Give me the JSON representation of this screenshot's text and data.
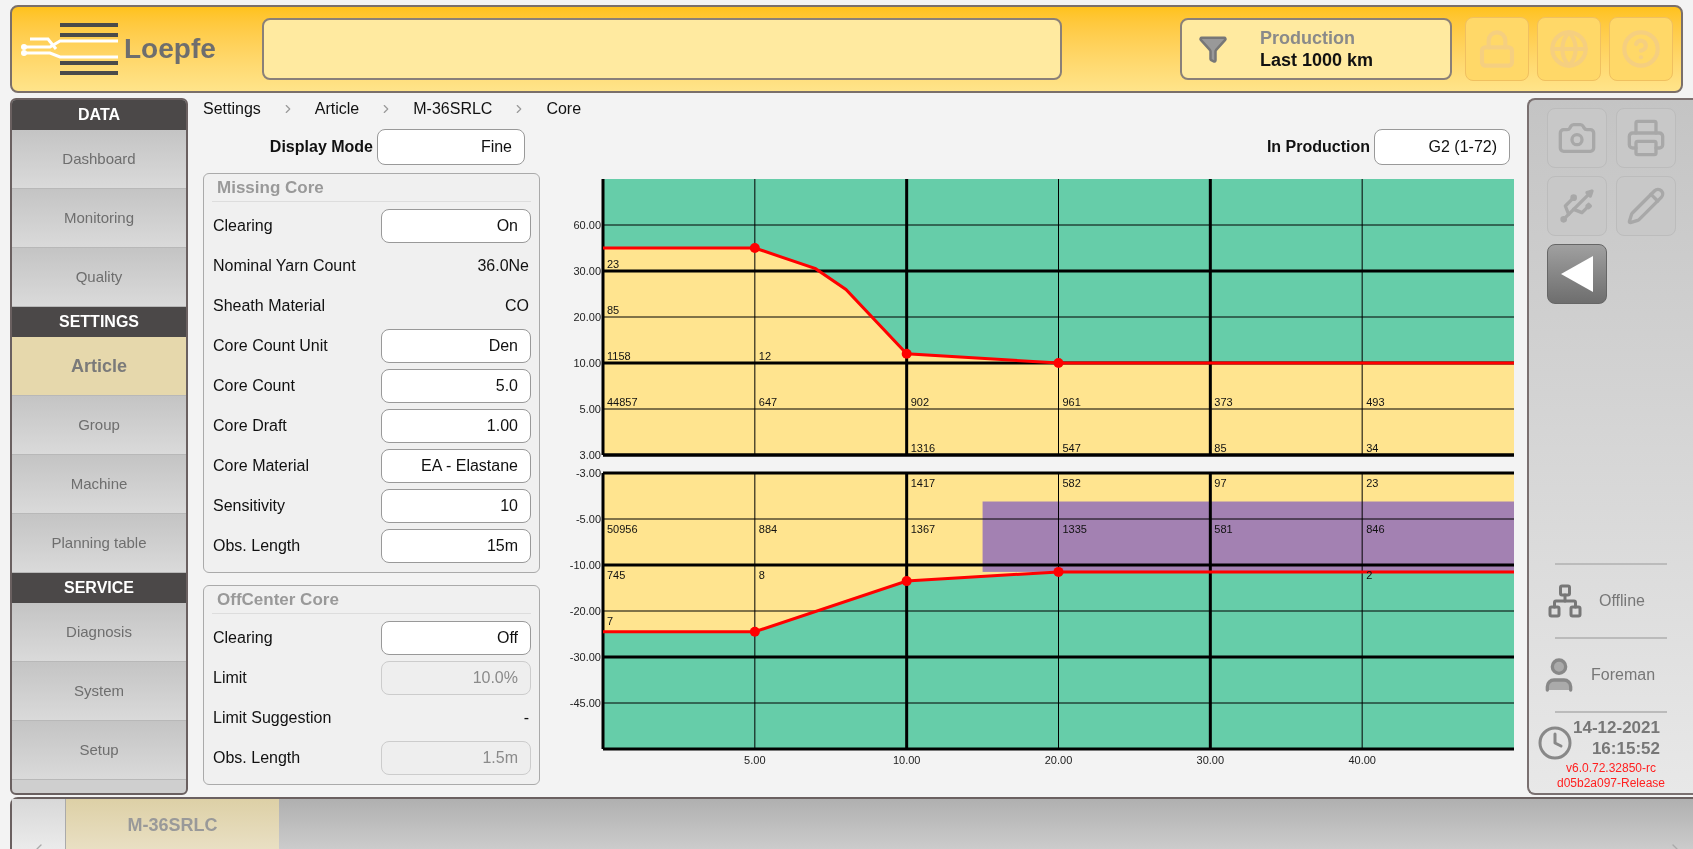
{
  "header": {
    "logo": "Loepfe",
    "filter": {
      "title": "Production",
      "value": "Last 1000 km"
    },
    "buttons": [
      {
        "kind": "lock",
        "disabled": true
      },
      {
        "kind": "globe",
        "disabled": true
      },
      {
        "kind": "help",
        "disabled": true
      }
    ]
  },
  "sidebar": {
    "sections": [
      {
        "title": "DATA",
        "items": [
          {
            "label": "Dashboard",
            "selected": false
          },
          {
            "label": "Monitoring",
            "selected": false
          },
          {
            "label": "Quality",
            "selected": false
          }
        ]
      },
      {
        "title": "SETTINGS",
        "items": [
          {
            "label": "Article",
            "selected": true
          },
          {
            "label": "Group",
            "selected": false
          },
          {
            "label": "Machine",
            "selected": false
          },
          {
            "label": "Planning table",
            "selected": false
          }
        ]
      },
      {
        "title": "SERVICE",
        "items": [
          {
            "label": "Diagnosis",
            "selected": false
          },
          {
            "label": "System",
            "selected": false
          },
          {
            "label": "Setup",
            "selected": false
          }
        ]
      }
    ]
  },
  "breadcrumb": [
    "Settings",
    "Article",
    "M-36SRLC",
    "Core"
  ],
  "display_mode": {
    "label": "Display Mode",
    "value": "Fine"
  },
  "in_production": {
    "label": "In Production",
    "value": "G2 (1-72)"
  },
  "groups": [
    {
      "title": "Missing Core",
      "rows": [
        {
          "label": "Clearing",
          "value": "On",
          "kind": "field",
          "disabled": false
        },
        {
          "label": "Nominal Yarn Count",
          "value": "36.0Ne",
          "kind": "text",
          "disabled": false
        },
        {
          "label": "Sheath Material",
          "value": "CO",
          "kind": "text",
          "disabled": false
        },
        {
          "label": "Core Count Unit",
          "value": "Den",
          "kind": "field",
          "disabled": false
        },
        {
          "label": "Core Count",
          "value": "5.0",
          "kind": "field",
          "disabled": false
        },
        {
          "label": "Core Draft",
          "value": "1.00",
          "kind": "field",
          "disabled": false
        },
        {
          "label": "Core Material",
          "value": "EA - Elastane",
          "kind": "field",
          "disabled": false
        },
        {
          "label": "Sensitivity",
          "value": "10",
          "kind": "field",
          "disabled": false
        },
        {
          "label": "Obs. Length",
          "value": "15m",
          "kind": "field",
          "disabled": false
        }
      ]
    },
    {
      "title": "OffCenter Core",
      "rows": [
        {
          "label": "Clearing",
          "value": "Off",
          "kind": "field",
          "disabled": false
        },
        {
          "label": "Limit",
          "value": "10.0%",
          "kind": "field",
          "disabled": true
        },
        {
          "label": "Limit Suggestion",
          "value": "-",
          "kind": "text",
          "disabled": false
        },
        {
          "label": "Obs. Length",
          "value": "1.5m",
          "kind": "field",
          "disabled": true
        }
      ]
    }
  ],
  "grids": [
    {
      "lines": [
        {
          "label": "60.00"
        },
        {
          "label": "30.00",
          "counts": [
            {
              "kind": "count",
              "text": "23"
            }
          ]
        },
        {
          "label": "20.00",
          "counts": [
            {
              "kind": "count",
              "text": "85"
            }
          ]
        },
        {
          "label": "10.00",
          "counts": [
            {
              "kind": "count",
              "text": "1158"
            },
            {
              "kind": "count",
              "text": "12"
            }
          ]
        },
        {
          "label": "5.00",
          "counts": [
            {
              "kind": "count",
              "text": "44857"
            },
            {
              "kind": "count",
              "text": "647"
            },
            {
              "kind": "count",
              "text": "902"
            },
            {
              "kind": "count",
              "text": "961"
            },
            {
              "kind": "count",
              "text": "373"
            },
            {
              "kind": "count",
              "text": "493"
            }
          ]
        },
        {
          "label": "3.00",
          "counts": [
            {
              "kind": "blank"
            },
            {
              "kind": "blank"
            },
            {
              "kind": "count",
              "text": "1316"
            },
            {
              "kind": "count",
              "text": "547"
            },
            {
              "kind": "count",
              "text": "85"
            },
            {
              "kind": "count",
              "text": "34"
            }
          ]
        }
      ]
    },
    {
      "lines": [
        {
          "label": "-3.00",
          "counts": [
            {
              "kind": "blank"
            },
            {
              "kind": "blank"
            },
            {
              "kind": "count",
              "text": "1417"
            },
            {
              "kind": "count",
              "text": "582"
            },
            {
              "kind": "count",
              "text": "97"
            },
            {
              "kind": "count",
              "text": "23"
            }
          ]
        },
        {
          "label": "-5.00",
          "counts": [
            {
              "kind": "count",
              "text": "50956"
            },
            {
              "kind": "count",
              "text": "884"
            },
            {
              "kind": "count",
              "text": "1367"
            },
            {
              "kind": "count",
              "text": "1335"
            },
            {
              "kind": "count",
              "text": "581"
            },
            {
              "kind": "count",
              "text": "846"
            }
          ]
        },
        {
          "label": "-10.00",
          "counts": [
            {
              "kind": "count",
              "text": "745"
            },
            {
              "kind": "count",
              "text": "8"
            },
            {
              "kind": "blank"
            },
            {
              "kind": "blank"
            },
            {
              "kind": "blank"
            },
            {
              "kind": "count",
              "text": "2"
            }
          ]
        },
        {
          "label": "-20.00",
          "counts": [
            {
              "kind": "count",
              "text": "7"
            }
          ]
        },
        {
          "label": "-30.00"
        },
        {
          "label": "-45.00"
        }
      ],
      "column_labels": [
        "5.00",
        "10.00",
        "20.00",
        "30.00",
        "40.00"
      ]
    }
  ],
  "right_panel": {
    "tools": [
      {
        "kind": "camera",
        "disabled": true
      },
      {
        "kind": "printer",
        "disabled": true
      },
      {
        "kind": "usb",
        "disabled": true
      },
      {
        "kind": "pencil",
        "disabled": true
      },
      {
        "kind": "back",
        "disabled": false
      }
    ],
    "connection": "Offline",
    "user": "Foreman",
    "date": "14-12-2021",
    "time": "16:15:52",
    "version": [
      "v6.0.72.32850-rc",
      "d05b2a097-Release"
    ]
  },
  "bottom_tabs": [
    {
      "label": "M-36SRLC",
      "selected": true
    }
  ]
}
